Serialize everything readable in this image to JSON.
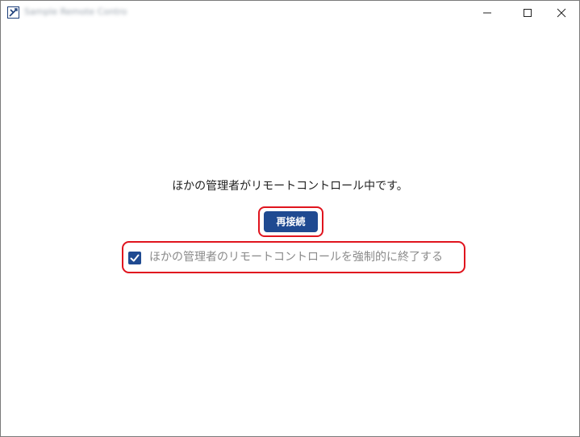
{
  "window": {
    "title": "Sample Remote Control",
    "icon": "app-logo-icon",
    "controls": {
      "minimize_icon": "minimize-icon",
      "maximize_icon": "maximize-icon",
      "close_icon": "close-icon"
    }
  },
  "main": {
    "message": "ほかの管理者がリモートコントロール中です。",
    "reconnect_label": "再接続",
    "force_end_label": "ほかの管理者のリモートコントロールを強制的に終了する",
    "force_end_checked": true
  },
  "colors": {
    "button_bg": "#1f4a91",
    "highlight": "#e0141e",
    "checkbox_bg": "#1f4a91"
  }
}
